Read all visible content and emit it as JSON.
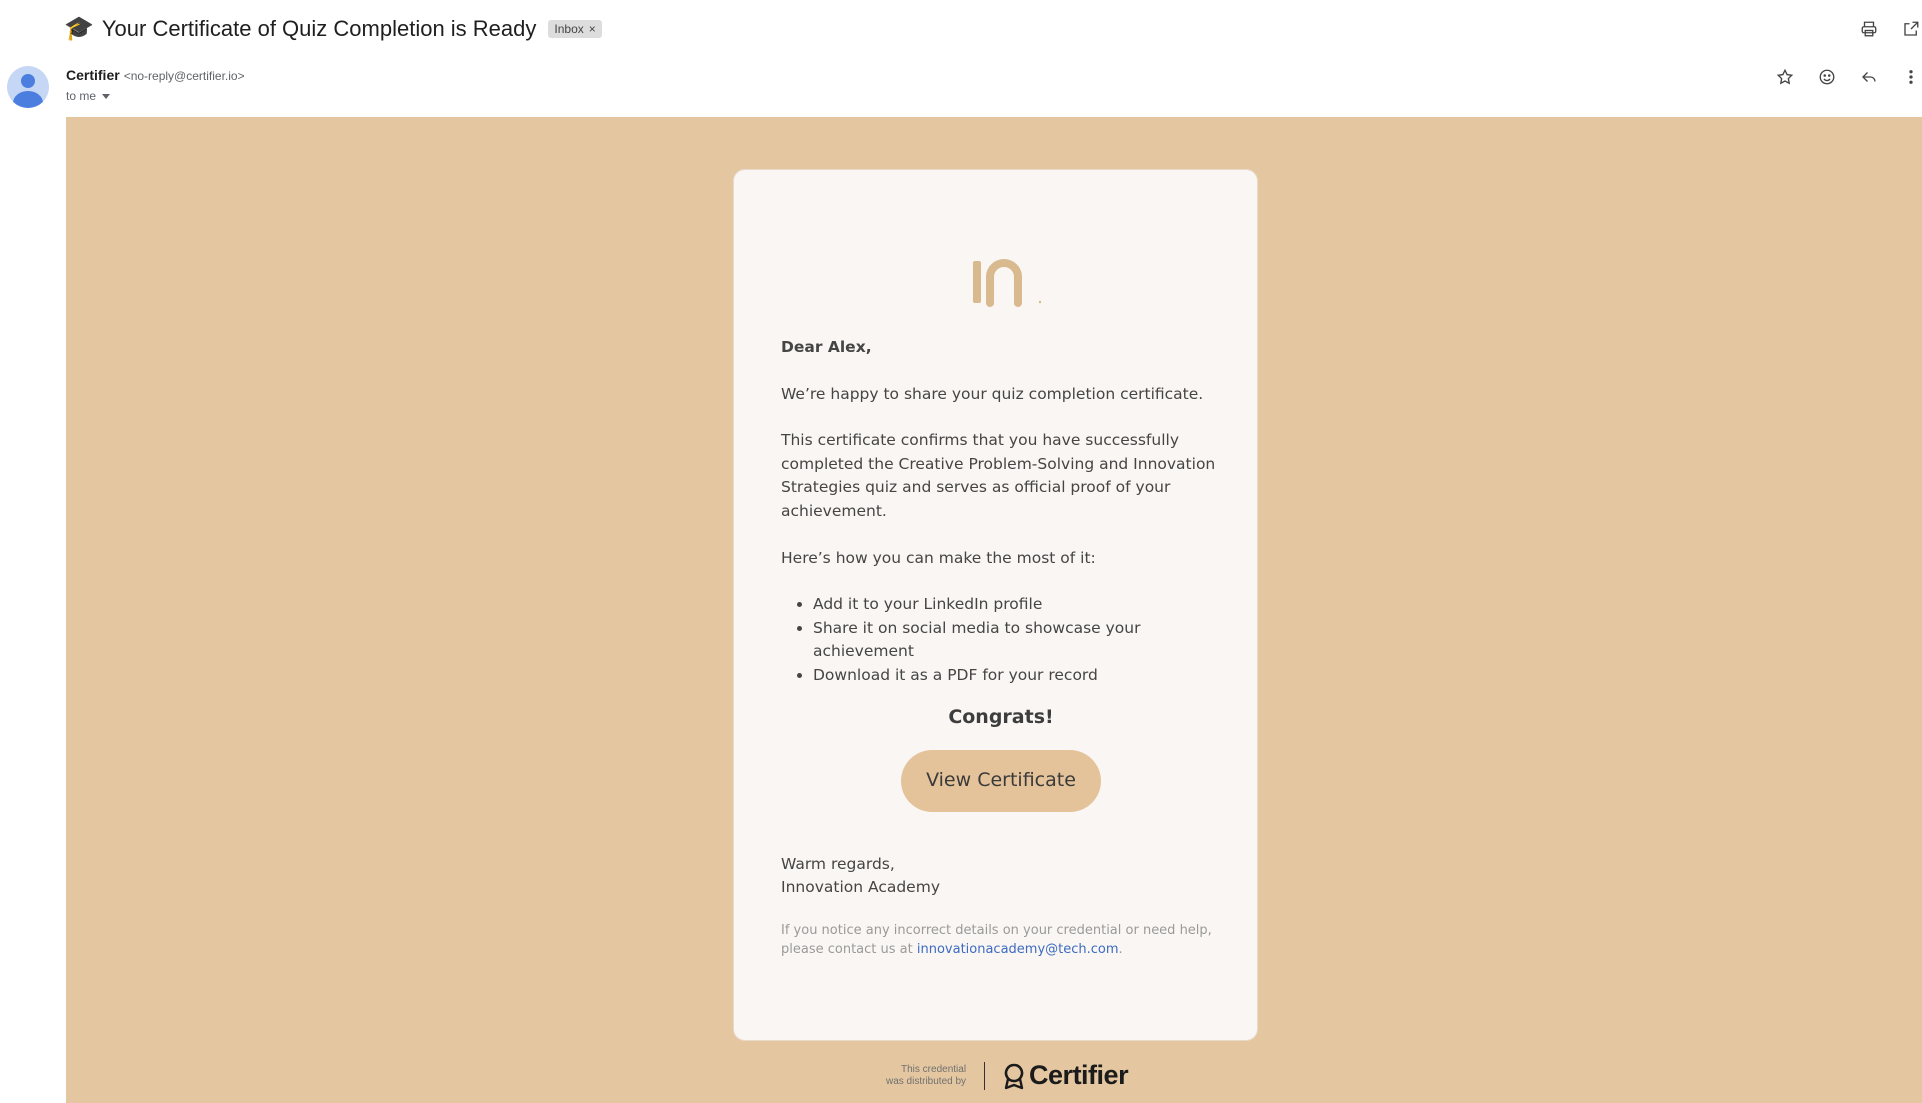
{
  "header": {
    "subject_emoji": "🎓",
    "subject": "Your Certificate of Quiz Completion is Ready",
    "label_chip": "Inbox",
    "label_chip_close": "×"
  },
  "sender": {
    "name": "Certifier",
    "email": "<no-reply@certifier.io>",
    "recipient": "to me"
  },
  "email": {
    "greeting": "Dear Alex,",
    "intro": "We’re happy to share your quiz completion certificate.",
    "confirmation": "This certificate confirms that you have successfully completed the Creative Problem-Solving and Innovation Strategies quiz and serves as official proof of your achievement.",
    "howto": "Here’s how you can make the most of it:",
    "bullets": [
      "Add it to your LinkedIn profile",
      "Share it on social media to showcase your achievement",
      "Download it as a PDF for your record"
    ],
    "congrats": "Congrats!",
    "cta_label": "View Certificate",
    "signoff_line1": "Warm regards,",
    "signoff_line2": "Innovation Academy",
    "footer_text": "If you notice any incorrect details on your credential or need help, please contact us at ",
    "footer_email": "innovationacademy@tech.com",
    "footer_end": "."
  },
  "distributed": {
    "line1": "This credential",
    "line2": "was distributed by",
    "brand": "Certifier"
  },
  "colors": {
    "body_background": "#e4c7a0",
    "card_background": "#faf6f3",
    "button": "#e4c39b",
    "logo": "#d9b98e",
    "link": "#3c6bc3"
  },
  "icons": {
    "top_actions": [
      "print-icon",
      "open-in-new-window-icon"
    ],
    "sender_actions": [
      "star-icon",
      "emoji-reaction-icon",
      "reply-icon",
      "more-vert-icon"
    ]
  }
}
